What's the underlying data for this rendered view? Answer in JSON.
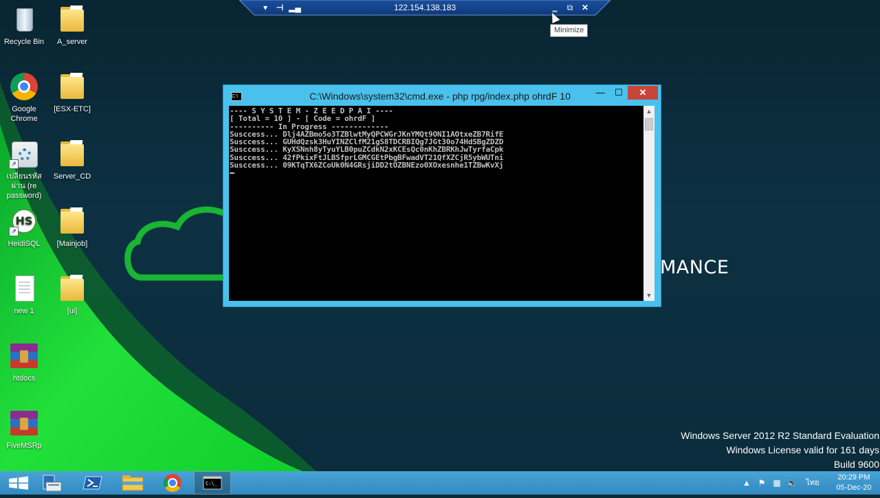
{
  "rdp_bar": {
    "host": "122.154.138.183",
    "pin_icon": "pin-icon",
    "signal_icon": "connection-signal-icon",
    "minimize_icon": "minimize-icon",
    "restore_icon": "restore-icon",
    "close_icon": "close-icon",
    "tooltip": "Minimize"
  },
  "desktop": {
    "icons": [
      {
        "label": "Recycle Bin",
        "icon": "recycle-bin-icon"
      },
      {
        "label": "A_server",
        "icon": "folder-icon"
      },
      {
        "label": "Google Chrome",
        "icon": "chrome-icon"
      },
      {
        "label": "[ESX-ETC]",
        "icon": "folder-icon"
      },
      {
        "label": "เปลี่ยนรหัสผ่าน (re password)",
        "icon": "settings-icon"
      },
      {
        "label": "Server_CD",
        "icon": "folder-icon"
      },
      {
        "label": "HeidiSQL",
        "icon": "heidisql-icon"
      },
      {
        "label": "[Mainjob]",
        "icon": "folder-icon"
      },
      {
        "label": "new 1",
        "icon": "text-file-icon"
      },
      {
        "label": "[ui]",
        "icon": "folder-icon"
      },
      {
        "label": "htdocs",
        "icon": "winrar-icon"
      },
      {
        "label": "FiveMSRp",
        "icon": "winrar-icon"
      }
    ],
    "wallpaper_text": "MANCE"
  },
  "cmd_window": {
    "title": "C:\\Windows\\system32\\cmd.exe - php  rpg/index.php ohrdF 10",
    "app_icon": "cmd-icon",
    "minimize_icon": "minimize-icon",
    "maximize_icon": "maximize-icon",
    "close_icon": "close-icon",
    "lines": [
      "---- S Y S T E M - Z E E D P A I ----",
      "[ Total = 10 ] - [ Code = ohrdF ]",
      "---------- In Progress -------------",
      "Susccess... Dlj4AZBmo5o3TZBlwtMyQPCWGrJKnYMQt9ONI1AOtxeZB7RifE",
      "Susccess... GUHdQzsk3HuYINZClfM21gS8TDCRBIQg7JGt30o74HdSBgZDZD",
      "Susccess... KyXSNnh8yTyuYLB0puZCdkN2xKCEsQc0nKhZBRKhJwTyrfaCpk",
      "Susccess... 42fPkixFtJLBSfprLGMCGEtPbgBFwadVT21QfXZCjR5ybWUTni",
      "Susccess... 09KTqTX6ZCoUk0N4GRsjiDD2tOZBNEzo0XOxesnhe1TZBwKvXj"
    ],
    "scroll_up_icon": "scroll-up-arrow-icon",
    "scroll_down_icon": "scroll-down-arrow-icon"
  },
  "watermark": {
    "line1": "Windows Server 2012 R2 Standard Evaluation",
    "line2": "Windows License valid for 161 days",
    "line3": "Build 9600"
  },
  "taskbar": {
    "items": [
      {
        "name": "start-button",
        "icon": "windows-logo-icon"
      },
      {
        "name": "server-manager",
        "icon": "server-manager-icon"
      },
      {
        "name": "powershell",
        "icon": "powershell-icon"
      },
      {
        "name": "file-explorer",
        "icon": "file-explorer-icon"
      },
      {
        "name": "chrome",
        "icon": "chrome-icon"
      },
      {
        "name": "cmd",
        "icon": "cmd-icon",
        "active": true
      }
    ],
    "tray": {
      "show_hidden_icon": "chevron-up-icon",
      "icons": [
        "action-center-flag-icon",
        "network-icon",
        "volume-icon"
      ],
      "language": "ไทย",
      "time": "20:29 PM",
      "date": "05-Dec-20"
    }
  },
  "colors": {
    "accent": "#49c1ec",
    "close_red": "#c7463a",
    "wallpaper_green": "#22e03a",
    "taskbar": "#3d8fc4"
  }
}
